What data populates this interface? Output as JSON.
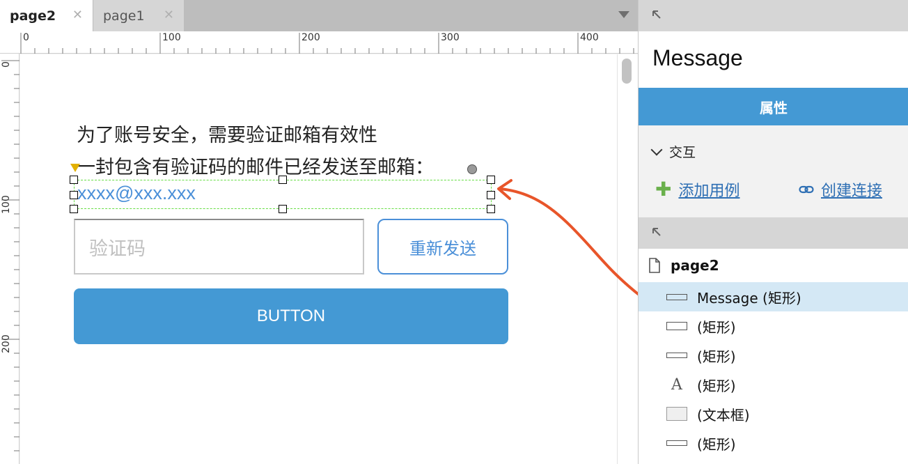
{
  "tabs": [
    {
      "label": "page2",
      "active": true
    },
    {
      "label": "page1",
      "active": false
    }
  ],
  "ruler": {
    "top_labels": [
      "0",
      "100",
      "200",
      "300",
      "400"
    ],
    "left_labels": [
      "0",
      "100",
      "200"
    ]
  },
  "canvas": {
    "intro_line_1": "为了账号安全，需要验证邮箱有效性",
    "intro_line_2": "一封包含有验证码的邮件已经发送至邮箱：",
    "email": "xxxx@xxx.xxx",
    "code_placeholder": "验证码",
    "resend_label": "重新发送",
    "button_label": "BUTTON"
  },
  "panel": {
    "widget_name": "Message",
    "properties_tab": "属性",
    "interaction_label": "交互",
    "add_case_label": "添加用例",
    "create_link_label": "创建连接"
  },
  "outline": {
    "page_name": "page2",
    "items": [
      {
        "label": "Message (矩形)",
        "icon": "rectangle-icon",
        "selected": true
      },
      {
        "label": "(矩形)",
        "icon": "rectangle-icon",
        "selected": false
      },
      {
        "label": "(矩形)",
        "icon": "rectangle-icon",
        "selected": false
      },
      {
        "label": "(矩形)",
        "icon": "text-icon",
        "selected": false
      },
      {
        "label": "(文本框)",
        "icon": "textbox-icon",
        "selected": false
      },
      {
        "label": "(矩形)",
        "icon": "rectangle-icon",
        "selected": false
      }
    ]
  },
  "colors": {
    "accent": "#4499d4",
    "link": "#2e6fb4",
    "selection_guide": "#66dd44",
    "annotation": "#e8552a"
  }
}
